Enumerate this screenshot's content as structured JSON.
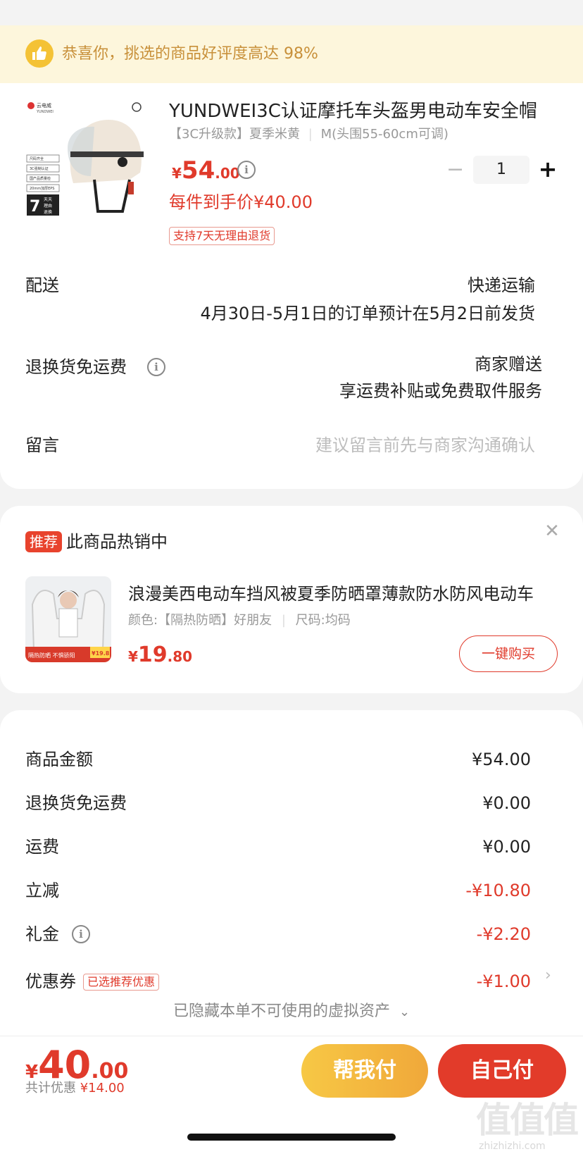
{
  "banner": {
    "text": "恭喜你，挑选的商品好评度高达 98%"
  },
  "product": {
    "title": "YUNDWEI3C认证摩托车头盔男电动车安全帽",
    "spec_color": "【3C升级款】夏季米黄",
    "spec_size": "M(头围55-60cm可调)",
    "price_symbol": "¥",
    "price_int": "54",
    "price_dec": ".00",
    "per_price": "每件到手价¥40.00",
    "return_tag": "支持7天无理由退货",
    "qty": "1",
    "img_brand": "云电威",
    "img_brand_en": "YUNDWEI",
    "img_labels": [
      "尺码齐全",
      "3C强制认证",
      "国产品质量检",
      "20mm加厚EPS"
    ],
    "img_days_num": "7",
    "img_days_text": [
      "天天",
      "理由",
      "退换"
    ]
  },
  "delivery": {
    "label": "配送",
    "method": "快递运输",
    "estimate": "4月30日-5月1日的订单预计在5月2日前发货"
  },
  "return_shipping": {
    "label": "退换货免运费",
    "value1": "商家赠送",
    "value2": "享运费补贴或免费取件服务"
  },
  "message": {
    "label": "留言",
    "placeholder": "建议留言前先与商家沟通确认"
  },
  "recommend": {
    "badge": "推荐",
    "title": "此商品热销中",
    "item_name": "浪漫美西电动车挡风被夏季防晒罩薄款防水防风电动车",
    "item_spec_color": "颜色:【隔热防晒】好朋友",
    "item_spec_size": "尺码:均码",
    "price_symbol": "¥",
    "price_int": "19",
    "price_dec": ".80",
    "buy_label": "一键购买",
    "img_caption": "隔热防晒 不惧骄阳",
    "img_price": "¥19.8"
  },
  "summary": {
    "rows": [
      {
        "label": "商品金额",
        "value": "¥54.00"
      },
      {
        "label": "退换货免运费",
        "value": "¥0.00"
      },
      {
        "label": "运费",
        "value": "¥0.00"
      },
      {
        "label": "立减",
        "value": "-¥10.80"
      },
      {
        "label": "礼金",
        "value": "-¥2.20"
      },
      {
        "label": "优惠券",
        "value": "-¥1.00"
      }
    ],
    "coupon_tag": "已选推荐优惠",
    "hidden_assets": "已隐藏本单不可使用的虚拟资产"
  },
  "footer": {
    "total_symbol": "¥",
    "total_int": "40",
    "total_dec": ".00",
    "discount_label": "共计优惠",
    "discount_value": "¥14.00",
    "help_pay": "帮我付",
    "self_pay": "自己付"
  },
  "watermark": {
    "text": "值值值",
    "site": "zhizhizhi.com"
  },
  "colors": {
    "accent_red": "#e03a2b",
    "banner_bg": "#fdf6dc",
    "help_btn": "#f0b53d"
  }
}
